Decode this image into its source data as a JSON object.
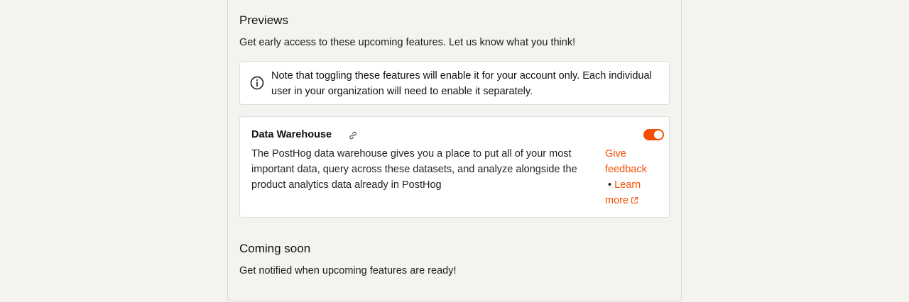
{
  "previews": {
    "heading": "Previews",
    "subtitle": "Get early access to these upcoming features. Let us know what you think!",
    "notice": "Note that toggling these features will enable it for your account only. Each individual user in your organization will need to enable it separately."
  },
  "features": [
    {
      "title": "Data Warehouse",
      "description": "The PostHog data warehouse gives you a place to put all of your most important data, query across these datasets, and analyze alongside the product analytics data already in PostHog",
      "enabled": true,
      "feedback_label": "Give feedback",
      "separator": "•",
      "learn_more_label": "Learn more"
    }
  ],
  "coming_soon": {
    "heading": "Coming soon",
    "subtitle": "Get notified when upcoming features are ready!"
  },
  "colors": {
    "accent": "#f54e00",
    "background": "#f3f3ef"
  }
}
